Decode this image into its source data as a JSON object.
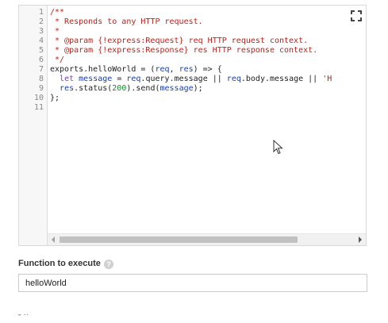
{
  "editor": {
    "line_numbers": [
      "1",
      "2",
      "3",
      "4",
      "5",
      "6",
      "7",
      "8",
      "9",
      "10",
      "11"
    ],
    "lines": [
      [
        {
          "t": "/**",
          "c": "c"
        }
      ],
      [
        {
          "t": " * Responds to any HTTP request.",
          "c": "c"
        }
      ],
      [
        {
          "t": " *",
          "c": "c"
        }
      ],
      [
        {
          "t": " * @param {!express:Request} req HTTP request context.",
          "c": "c"
        }
      ],
      [
        {
          "t": " * @param {!express:Response} res HTTP response context.",
          "c": "c"
        }
      ],
      [
        {
          "t": " */",
          "c": "c"
        }
      ],
      [
        {
          "t": "exports.helloWorld = (",
          "c": ""
        },
        {
          "t": "req",
          "c": "p"
        },
        {
          "t": ", ",
          "c": ""
        },
        {
          "t": "res",
          "c": "p"
        },
        {
          "t": ") => {",
          "c": ""
        }
      ],
      [
        {
          "t": "  ",
          "c": ""
        },
        {
          "t": "let",
          "c": "k"
        },
        {
          "t": " ",
          "c": ""
        },
        {
          "t": "message",
          "c": "p"
        },
        {
          "t": " = ",
          "c": ""
        },
        {
          "t": "req",
          "c": "p"
        },
        {
          "t": ".query.message || ",
          "c": ""
        },
        {
          "t": "req",
          "c": "p"
        },
        {
          "t": ".body.message || ",
          "c": ""
        },
        {
          "t": "'H",
          "c": "s"
        }
      ],
      [
        {
          "t": "  ",
          "c": ""
        },
        {
          "t": "res",
          "c": "p"
        },
        {
          "t": ".status(",
          "c": ""
        },
        {
          "t": "200",
          "c": "n"
        },
        {
          "t": ").send(",
          "c": ""
        },
        {
          "t": "message",
          "c": "p"
        },
        {
          "t": ");",
          "c": ""
        }
      ],
      [
        {
          "t": "};",
          "c": ""
        }
      ],
      [
        {
          "t": "",
          "c": ""
        }
      ]
    ],
    "fullscreen_icon": "fullscreen-icon",
    "scroll_arrow_left_icon": "chevron-left-icon",
    "scroll_arrow_right_icon": "chevron-right-icon"
  },
  "function_to_execute": {
    "label": "Function to execute",
    "help_icon": "?",
    "value": "helloWorld"
  },
  "truncated_text": "ˇ ˙˙",
  "colors": {
    "comment": "#b3261e",
    "keyword": "#7a3fb1",
    "param": "#1a3faa",
    "number": "#148a2e"
  }
}
